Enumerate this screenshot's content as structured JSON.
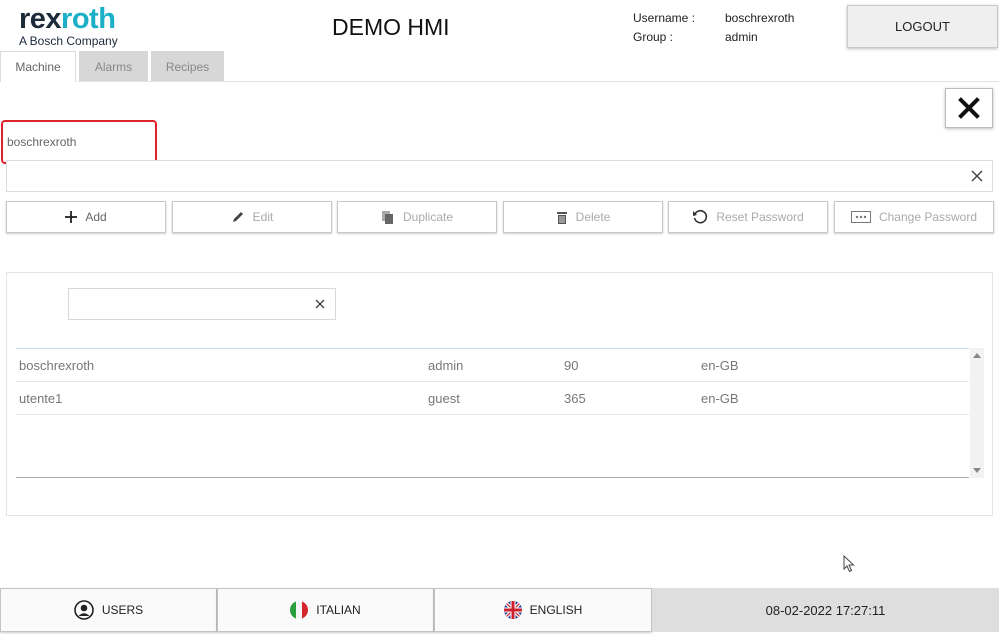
{
  "header": {
    "logo_main_a": "rex",
    "logo_main_b": "roth",
    "logo_sub": "A Bosch Company",
    "title": "DEMO HMI",
    "username_label": "Username :",
    "username_value": "boschrexroth",
    "group_label": "Group :",
    "group_value": "admin",
    "logout_label": "LOGOUT"
  },
  "tabs": [
    {
      "label": "Machine",
      "active": true
    },
    {
      "label": "Alarms",
      "active": false
    },
    {
      "label": "Recipes",
      "active": false
    }
  ],
  "selected_user": "boschrexroth",
  "filter": {
    "value": "",
    "placeholder": ""
  },
  "actions": {
    "add": "Add",
    "edit": "Edit",
    "duplicate": "Duplicate",
    "delete": "Delete",
    "reset_password": "Reset Password",
    "change_password": "Change Password"
  },
  "search": {
    "value": "",
    "placeholder": ""
  },
  "users": [
    {
      "name": "boschrexroth",
      "group": "admin",
      "expiry": "90",
      "language": "en-GB"
    },
    {
      "name": "utente1",
      "group": "guest",
      "expiry": "365",
      "language": "en-GB"
    }
  ],
  "footer": {
    "users_label": "USERS",
    "italian_label": "ITALIAN",
    "english_label": "ENGLISH",
    "datetime": "08-02-2022 17:27:11"
  },
  "colors": {
    "logo_accent": "#1bb0c8",
    "highlight_border": "#e0232b"
  }
}
